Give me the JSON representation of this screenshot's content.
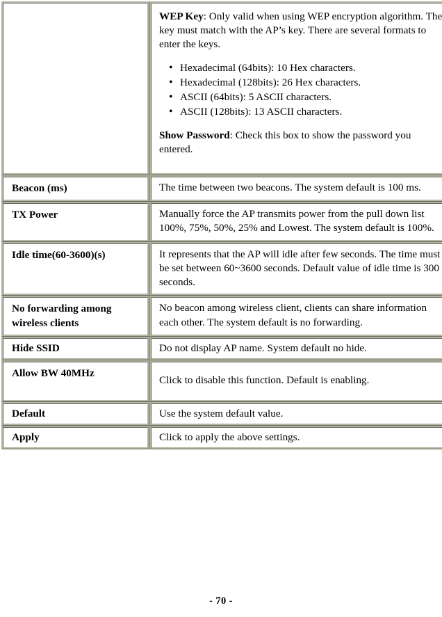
{
  "document": {
    "page_footer": "- 70 -"
  },
  "table": {
    "rows": [
      {
        "label": "",
        "is_continuation": true,
        "blocks": [
          {
            "type": "paragraph",
            "bold_lead": "WEP Key",
            "separator": ": ",
            "text": "Only valid when using WEP encryption algorithm. The key must match with the AP’s key. There are several formats to enter the keys."
          },
          {
            "type": "list",
            "items": [
              "Hexadecimal (64bits): 10 Hex characters.",
              "Hexadecimal (128bits): 26 Hex characters.",
              "ASCII (64bits): 5 ASCII characters.",
              "ASCII (128bits): 13 ASCII characters."
            ]
          },
          {
            "type": "paragraph",
            "bold_lead": "Show Password",
            "separator": ": ",
            "text": "Check this box to show the password you entered."
          }
        ]
      },
      {
        "label": "Beacon (ms)",
        "description": "The time between two beacons. The system default is 100 ms."
      },
      {
        "label": "TX Power",
        "description": "Manually force the AP transmits power from the pull down list 100%, 75%, 50%, 25% and Lowest. The system default is 100%."
      },
      {
        "label": "Idle time(60-3600)(s)",
        "description": "It represents that the AP will idle after few seconds. The time must be set between 60~3600 seconds. Default value of idle time is 300 seconds."
      },
      {
        "label": "No forwarding among wireless clients",
        "description": "No beacon among wireless client, clients can share information each other. The system default is no forwarding."
      },
      {
        "label": "Hide SSID",
        "description": "Do not display AP name. System default no hide."
      },
      {
        "label": "Allow BW 40MHz",
        "description": "Click to disable this function. Default is enabling."
      },
      {
        "label": "Default",
        "description": "Use the system default value."
      },
      {
        "label": "Apply",
        "description": "Click to apply the above settings."
      }
    ]
  }
}
